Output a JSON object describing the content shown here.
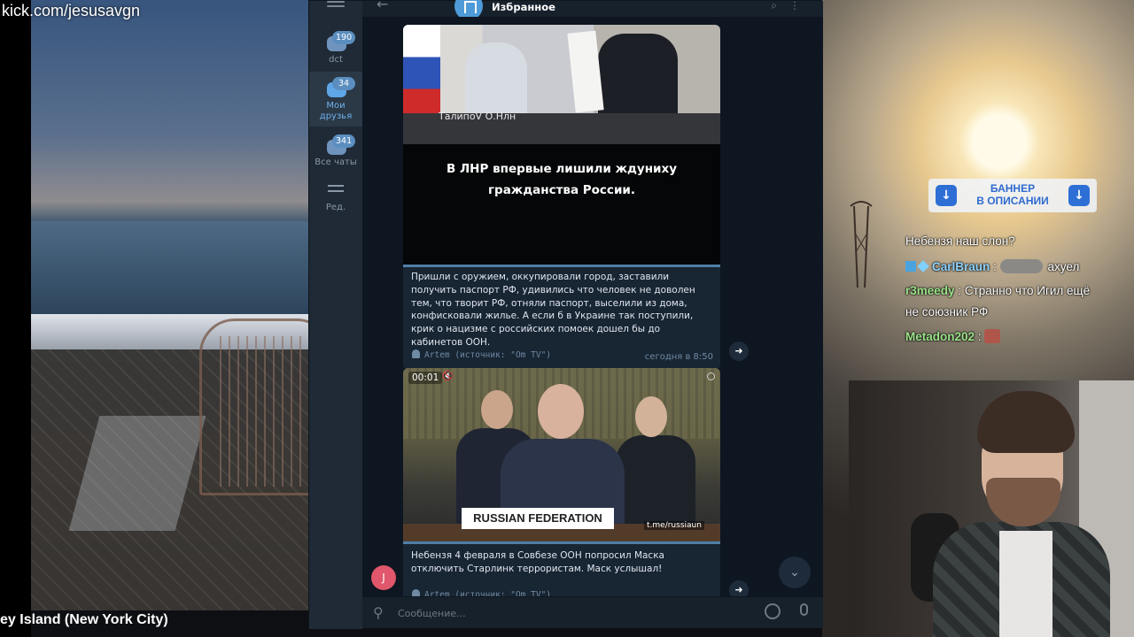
{
  "stream": {
    "url": "kick.com/jesusavgn",
    "place_caption": "ey Island (New York City)"
  },
  "telegram": {
    "sidebar": {
      "folders": [
        {
          "label": "dct",
          "badge": "190"
        },
        {
          "label": "Мои друзья",
          "badge": "34"
        },
        {
          "label": "Все чаты",
          "badge": "341"
        },
        {
          "label": "Ред.",
          "badge": ""
        }
      ]
    },
    "header": {
      "title": "Избранное"
    },
    "messages": [
      {
        "image_watermark": "ТалипоV О.Нлн",
        "image_text_line1": "В ЛНР впервые лишили ждуниху",
        "image_text_line2": "гражданства России.",
        "caption": "Пришли с оружием, оккупировали город, заставили получить паспорт РФ, удивились что человек не доволен тем, что творит РФ, отняли паспорт, выселили из дома, конфисковали жилье. А если б в Украине так поступили, крик о нацизме с российских помоек дошел бы до кабинетов ООН.",
        "author": "Artem (источник: \"Om TV\")",
        "time": "сегодня в 8:50"
      },
      {
        "video_time": "00:01",
        "nameplate": "RUSSIAN FEDERATION",
        "video_watermark": "t.me/russiaun",
        "caption": "Небензя 4 февраля в Совбезе ООН попросил Маска отключить Старлинк террористам. Маск услышал!",
        "author": "Artem (источник: \"Om TV\")",
        "avatar_letter": "J"
      }
    ],
    "composer": {
      "placeholder": "Сообщение..."
    }
  },
  "banner": {
    "line1": "БАННЕР",
    "line2": "В ОПИСАНИИ"
  },
  "stream_chat": [
    {
      "nick": "",
      "text": "Небензя наш слон?"
    },
    {
      "nick": "CarlBraun",
      "text": "ахуел"
    },
    {
      "nick": "r3meedy",
      "text": "Странно что Игил ещё"
    },
    {
      "nick": "",
      "text": "не союзник РФ"
    },
    {
      "nick": "Metadon202",
      "text": ""
    }
  ],
  "colors": {
    "accent": "#5ea6e6",
    "panel": "#17212b",
    "chat_bg": "#0e1621",
    "nick_green": "#9be38a",
    "nick_blue": "#8fd3ff"
  }
}
